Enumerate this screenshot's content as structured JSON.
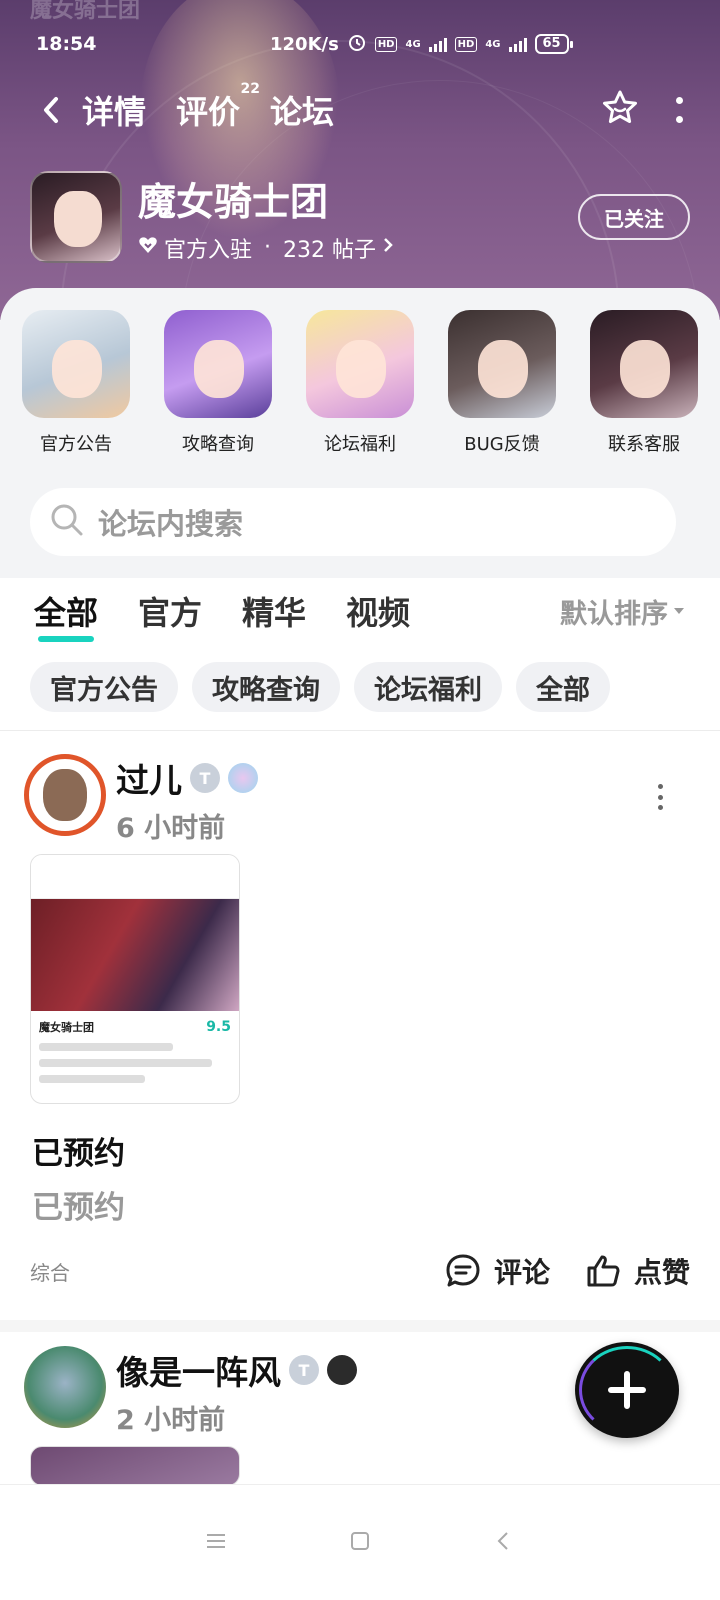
{
  "status": {
    "time": "18:54",
    "speed": "120K/s",
    "net1": "4G",
    "net2": "4G",
    "battery": "65"
  },
  "header": {
    "ghost_title": "魔女骑士团",
    "tabs": [
      {
        "label": "详情"
      },
      {
        "label": "评价",
        "badge": "22"
      },
      {
        "label": "论坛"
      }
    ]
  },
  "game": {
    "title": "魔女骑士团",
    "official": "官方入驻",
    "dot": "·",
    "posts": "232 帖子",
    "follow_label": "已关注"
  },
  "shortcuts": [
    {
      "label": "官方公告"
    },
    {
      "label": "攻略查询"
    },
    {
      "label": "论坛福利"
    },
    {
      "label": "BUG反馈"
    },
    {
      "label": "联系客服"
    }
  ],
  "search": {
    "placeholder": "论坛内搜索"
  },
  "filters": {
    "tabs": [
      "全部",
      "官方",
      "精华",
      "视频"
    ],
    "sort": "默认排序",
    "chips": [
      "官方公告",
      "攻略查询",
      "论坛福利",
      "全部"
    ]
  },
  "posts": [
    {
      "username": "过儿",
      "badge": "T",
      "time": "6 小时前",
      "thumb": {
        "title": "魔女骑士团",
        "score": "9.5"
      },
      "title": "已预约",
      "body": "已预约",
      "category": "综合",
      "comment_label": "评论",
      "like_label": "点赞"
    },
    {
      "username": "像是一阵风",
      "badge": "T",
      "time": "2 小时前"
    }
  ],
  "colors": {
    "accent": "#19d3bf",
    "hero": "#7b5585"
  }
}
